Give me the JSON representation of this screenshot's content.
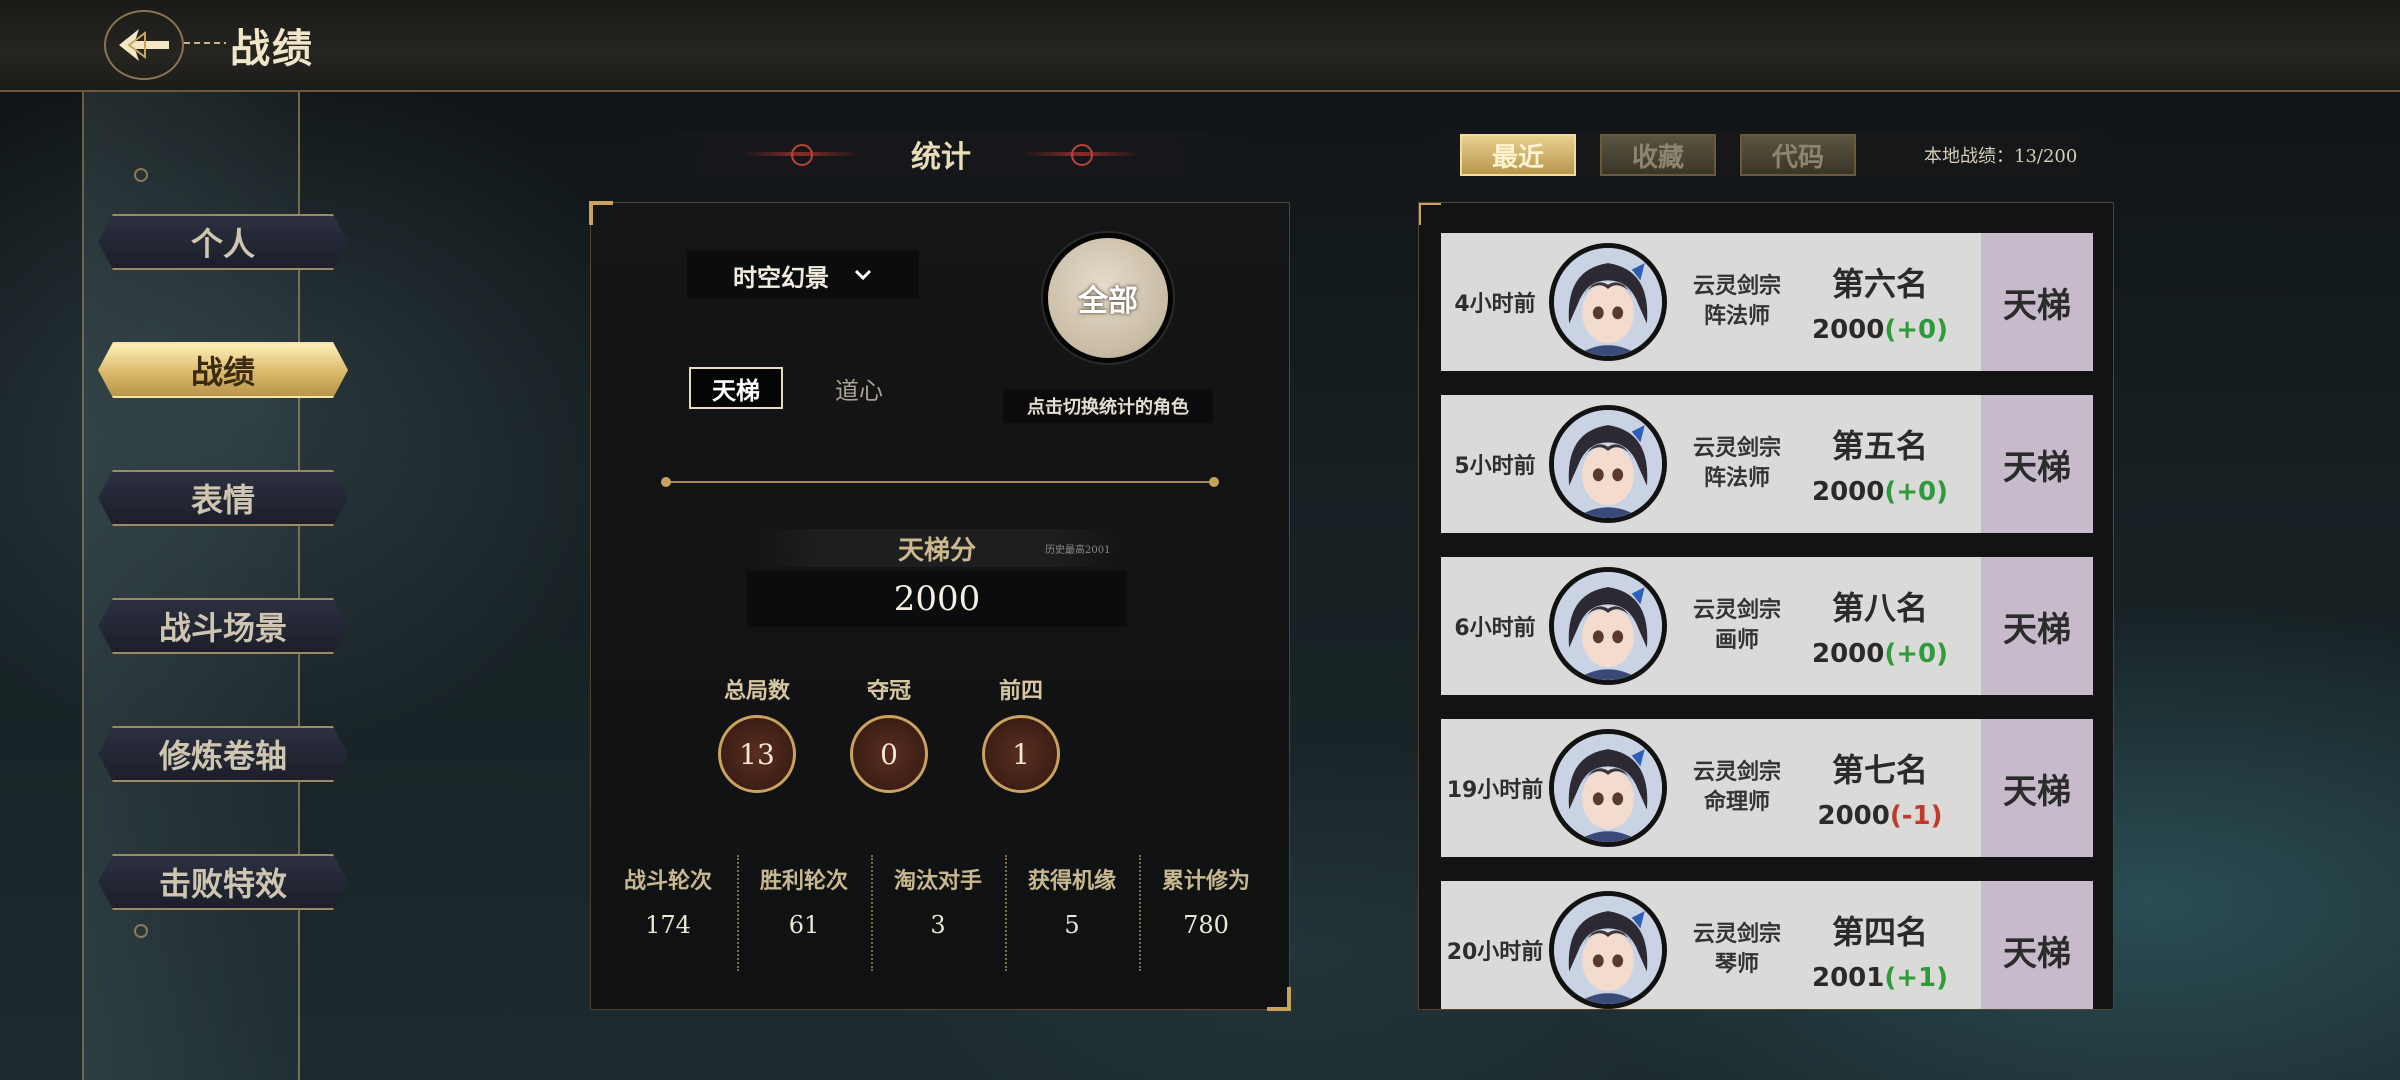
{
  "header": {
    "title": "战绩",
    "back_icon": "back-arrow-icon"
  },
  "sidebar": {
    "items": [
      {
        "label": "个人",
        "active": false
      },
      {
        "label": "战绩",
        "active": true
      },
      {
        "label": "表情",
        "active": false
      },
      {
        "label": "战斗场景",
        "active": false
      },
      {
        "label": "修炼卷轴",
        "active": false
      },
      {
        "label": "击败特效",
        "active": false
      }
    ]
  },
  "stats": {
    "title": "统计",
    "mode_select": {
      "value": "时空幻景",
      "icon": "chevron-down-icon"
    },
    "tabs": [
      {
        "label": "天梯",
        "active": true
      },
      {
        "label": "道心",
        "active": false
      }
    ],
    "role_button": "全部",
    "role_hint": "点击切换统计的角色",
    "score_label": "天梯分",
    "score_note": "历史最高2001",
    "score_value": "2000",
    "counts": [
      {
        "label": "总局数",
        "value": "13"
      },
      {
        "label": "夺冠",
        "value": "0"
      },
      {
        "label": "前四",
        "value": "1"
      }
    ],
    "footer": [
      {
        "label": "战斗轮次",
        "value": "174"
      },
      {
        "label": "胜利轮次",
        "value": "61"
      },
      {
        "label": "淘汰对手",
        "value": "3"
      },
      {
        "label": "获得机缘",
        "value": "5"
      },
      {
        "label": "累计修为",
        "value": "780"
      }
    ]
  },
  "records_panel": {
    "tabs": [
      {
        "label": "最近",
        "active": true
      },
      {
        "label": "收藏",
        "active": false
      },
      {
        "label": "代码",
        "active": false
      }
    ],
    "local_count": "本地战绩：13/200",
    "records": [
      {
        "time": "4小时前",
        "school": "云灵剑宗",
        "role": "阵法师",
        "rank": "第六名",
        "score": "2000",
        "delta": "(+0)",
        "delta_sign": "pos",
        "mode": "天梯"
      },
      {
        "time": "5小时前",
        "school": "云灵剑宗",
        "role": "阵法师",
        "rank": "第五名",
        "score": "2000",
        "delta": "(+0)",
        "delta_sign": "pos",
        "mode": "天梯"
      },
      {
        "time": "6小时前",
        "school": "云灵剑宗",
        "role": "画师",
        "rank": "第八名",
        "score": "2000",
        "delta": "(+0)",
        "delta_sign": "pos",
        "mode": "天梯"
      },
      {
        "time": "19小时前",
        "school": "云灵剑宗",
        "role": "命理师",
        "rank": "第七名",
        "score": "2000",
        "delta": "(-1)",
        "delta_sign": "neg",
        "mode": "天梯"
      },
      {
        "time": "20小时前",
        "school": "云灵剑宗",
        "role": "琴师",
        "rank": "第四名",
        "score": "2001",
        "delta": "(+1)",
        "delta_sign": "pos",
        "mode": "天梯"
      }
    ]
  },
  "colors": {
    "accent_gold": "#c9a25e",
    "positive": "#2e9a3c",
    "negative": "#c0392b",
    "mode_bg": "#c6bacb"
  }
}
